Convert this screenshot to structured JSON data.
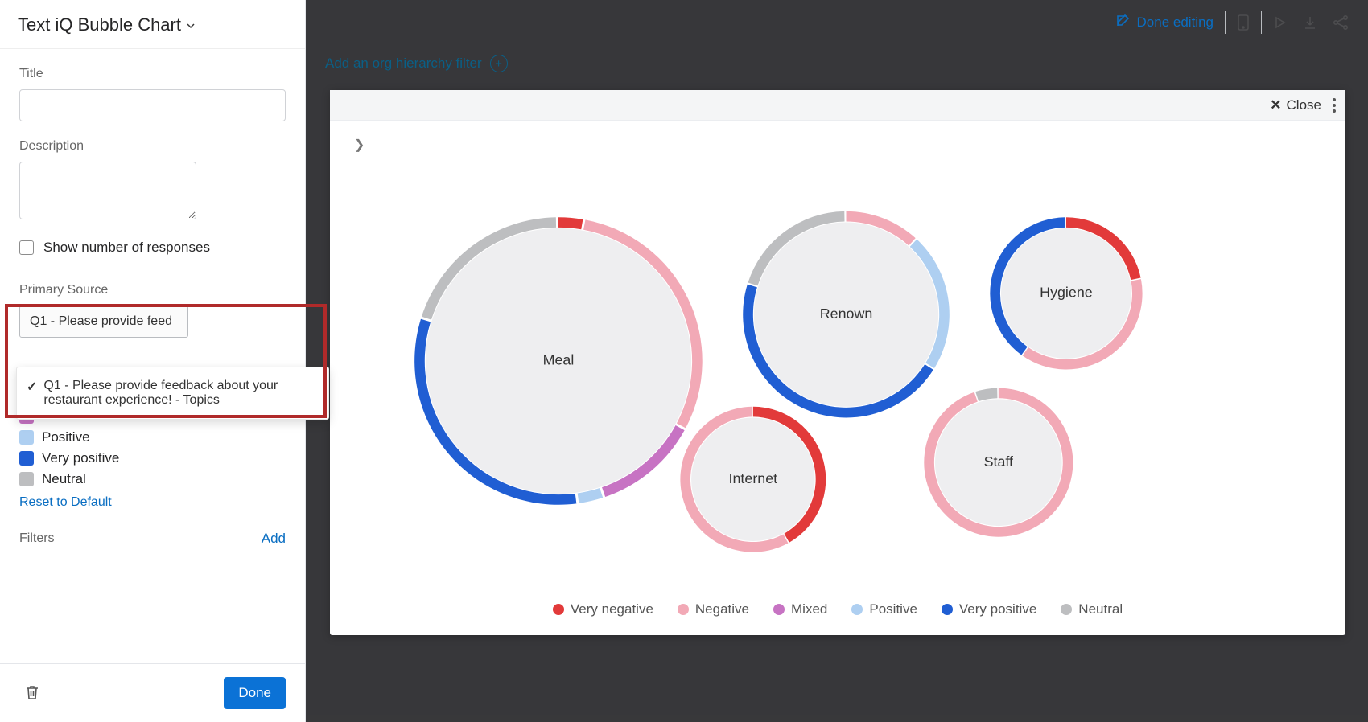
{
  "panelTitle": "Text iQ Bubble Chart",
  "fields": {
    "titleLabel": "Title",
    "descriptionLabel": "Description",
    "showResponsesLabel": "Show number of responses",
    "primarySourceLabel": "Primary Source",
    "primarySourceSelected": "Q1 - Please provide feed",
    "primarySourceOption": "Q1 - Please provide feedback about your restaurant experience! - Topics",
    "filtersLabel": "Filters",
    "addLabel": "Add",
    "resetLabel": "Reset to Default",
    "doneLabel": "Done"
  },
  "sentimentLegend": {
    "negative": "Negative",
    "mixed": "Mixed",
    "positive": "Positive",
    "veryPositive": "Very positive",
    "neutral": "Neutral"
  },
  "toolbar": {
    "doneEditing": "Done editing",
    "close": "Close",
    "orgFilter": "Add an org hierarchy filter"
  },
  "chartLegend": {
    "veryNegative": "Very negative",
    "negative": "Negative",
    "mixed": "Mixed",
    "positive": "Positive",
    "veryPositive": "Very positive",
    "neutral": "Neutral"
  },
  "chart_data": {
    "type": "bubble-donut",
    "description": "Topic bubbles sized by volume; ring segments show sentiment share per topic.",
    "sentiment_order": [
      "very_negative",
      "negative",
      "mixed",
      "positive",
      "very_positive",
      "neutral"
    ],
    "sentiment_colors": {
      "very_negative": "#e23a3a",
      "negative": "#f2a9b6",
      "mixed": "#c773c3",
      "positive": "#aecff1",
      "very_positive": "#205ed3",
      "neutral": "#bdbec0"
    },
    "topics": [
      {
        "name": "Meal",
        "relative_size": 1.0,
        "sentiment_share": {
          "very_negative": 3,
          "negative": 30,
          "mixed": 12,
          "positive": 3,
          "very_positive": 32,
          "neutral": 20
        }
      },
      {
        "name": "Renown",
        "relative_size": 0.7,
        "sentiment_share": {
          "very_negative": 0,
          "negative": 12,
          "mixed": 0,
          "positive": 22,
          "very_positive": 46,
          "neutral": 20
        }
      },
      {
        "name": "Hygiene",
        "relative_size": 0.52,
        "sentiment_share": {
          "very_negative": 22,
          "negative": 38,
          "mixed": 0,
          "positive": 0,
          "very_positive": 40,
          "neutral": 0
        }
      },
      {
        "name": "Staff",
        "relative_size": 0.52,
        "sentiment_share": {
          "very_negative": 0,
          "negative": 95,
          "mixed": 0,
          "positive": 0,
          "very_positive": 0,
          "neutral": 5
        }
      },
      {
        "name": "Internet",
        "relative_size": 0.5,
        "sentiment_share": {
          "very_negative": 42,
          "negative": 58,
          "mixed": 0,
          "positive": 0,
          "very_positive": 0,
          "neutral": 0
        }
      }
    ]
  }
}
